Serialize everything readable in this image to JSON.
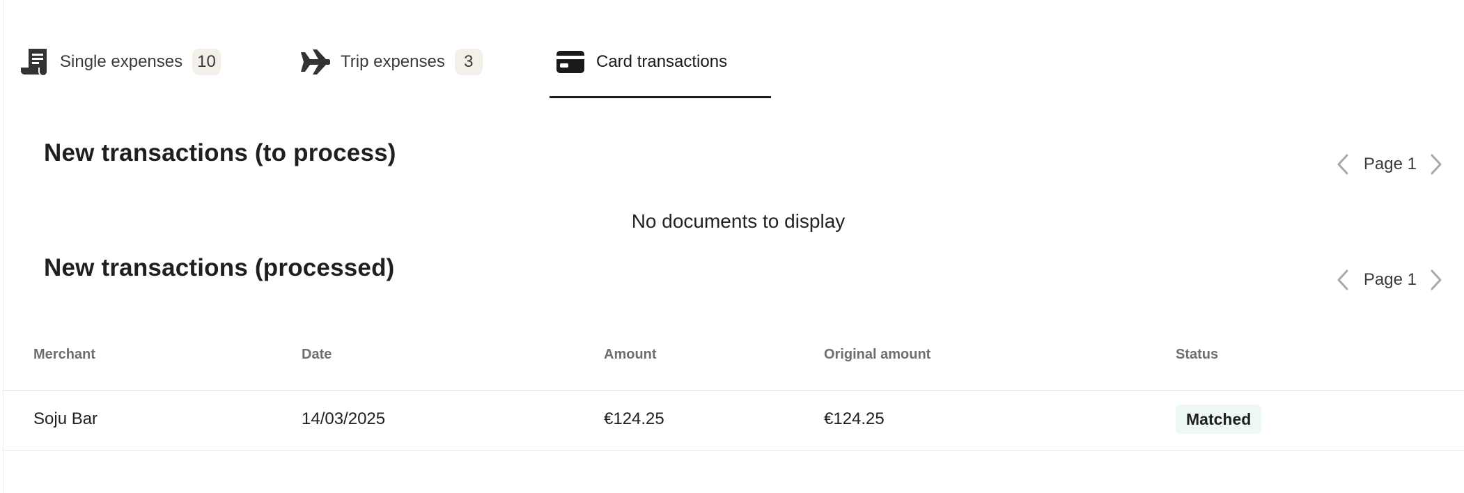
{
  "tabs": [
    {
      "label": "Single expenses",
      "count": "10",
      "icon": "receipt-icon"
    },
    {
      "label": "Trip expenses",
      "count": "3",
      "icon": "airplane-icon"
    },
    {
      "label": "Card transactions",
      "icon": "credit-card-icon",
      "active": true
    }
  ],
  "sections": {
    "to_process": {
      "title": "New transactions (to process)",
      "page_label": "Page 1",
      "empty_text": "No documents to display"
    },
    "processed": {
      "title": "New transactions (processed)",
      "page_label": "Page 1"
    }
  },
  "table": {
    "columns": [
      "Merchant",
      "Date",
      "Amount",
      "Original amount",
      "Status"
    ],
    "rows": [
      {
        "merchant": "Soju Bar",
        "date": "14/03/2025",
        "amount": "€124.25",
        "original_amount": "€124.25",
        "status": "Matched"
      }
    ]
  },
  "colors": {
    "text": "#1f1f1f",
    "muted": "#6f6e6a",
    "badge_bg": "#f2f0e8",
    "status_bg": "#eef8f6",
    "divider": "#e6e6e6",
    "pager_arrow": "#a8a8a8"
  }
}
